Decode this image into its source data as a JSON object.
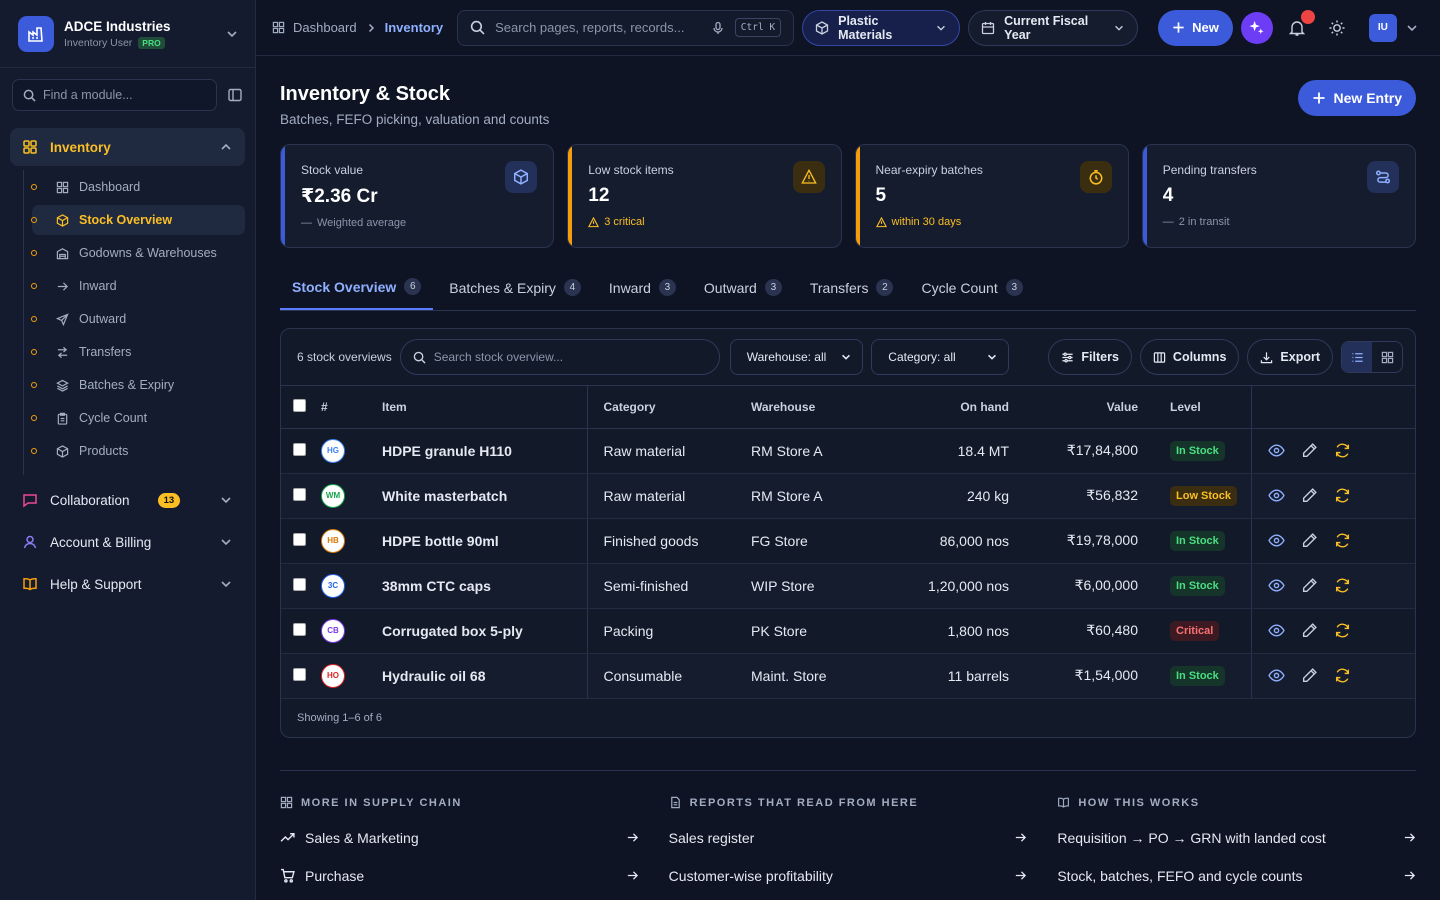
{
  "brand": {
    "name": "ADCE Industries",
    "role": "Inventory User",
    "plan": "PRO"
  },
  "sidebar": {
    "search_placeholder": "Find a module...",
    "group_inventory": "Inventory",
    "sub_items": [
      {
        "label": "Dashboard"
      },
      {
        "label": "Stock Overview"
      },
      {
        "label": "Godowns & Warehouses"
      },
      {
        "label": "Inward"
      },
      {
        "label": "Outward"
      },
      {
        "label": "Transfers"
      },
      {
        "label": "Batches & Expiry"
      },
      {
        "label": "Cycle Count"
      },
      {
        "label": "Products"
      }
    ],
    "collaboration": "Collaboration",
    "collab_badge": "13",
    "account": "Account & Billing",
    "help": "Help & Support"
  },
  "topbar": {
    "crumb_root": "Dashboard",
    "crumb_current": "Inventory",
    "search_placeholder": "Search pages, reports, records...",
    "shortcut": "Ctrl K",
    "context": "Plastic Materials",
    "period": "Current Fiscal Year",
    "new_label": "New",
    "user_initials": "IU"
  },
  "page": {
    "title": "Inventory & Stock",
    "subtitle": "Batches, FEFO picking, valuation and counts",
    "new_entry": "New Entry"
  },
  "kpis": [
    {
      "label": "Stock value",
      "value": "₹2.36 Cr",
      "note": "Weighted average",
      "color": "#3b5bdb"
    },
    {
      "label": "Low stock items",
      "value": "12",
      "note": "3 critical",
      "color": "#f59e0b"
    },
    {
      "label": "Near-expiry batches",
      "value": "5",
      "note": "within 30 days",
      "color": "#f59e0b"
    },
    {
      "label": "Pending transfers",
      "value": "4",
      "note": "2 in transit",
      "color": "#3b5bdb"
    }
  ],
  "tabs": [
    {
      "label": "Stock Overview",
      "count": "6"
    },
    {
      "label": "Batches & Expiry",
      "count": "4"
    },
    {
      "label": "Inward",
      "count": "3"
    },
    {
      "label": "Outward",
      "count": "3"
    },
    {
      "label": "Transfers",
      "count": "2"
    },
    {
      "label": "Cycle Count",
      "count": "3"
    }
  ],
  "table": {
    "count_label": "6 stock overviews",
    "search_placeholder": "Search stock overview...",
    "warehouse_filter": "Warehouse: all",
    "category_filter": "Category: all",
    "filters": "Filters",
    "columns_btn": "Columns",
    "export": "Export",
    "headers": {
      "num": "#",
      "item": "Item",
      "category": "Category",
      "warehouse": "Warehouse",
      "onhand": "On hand",
      "value": "Value",
      "level": "Level"
    },
    "rows": [
      {
        "ini": "HG",
        "color": "#3b82f6",
        "item": "HDPE granule H110",
        "category": "Raw material",
        "warehouse": "RM Store A",
        "onhand": "18.4 MT",
        "value": "₹17,84,800",
        "level": "In Stock",
        "lvl": "in"
      },
      {
        "ini": "WM",
        "color": "#16a34a",
        "item": "White masterbatch",
        "category": "Raw material",
        "warehouse": "RM Store A",
        "onhand": "240 kg",
        "value": "₹56,832",
        "level": "Low Stock",
        "lvl": "low"
      },
      {
        "ini": "HB",
        "color": "#d97706",
        "item": "HDPE bottle 90ml",
        "category": "Finished goods",
        "warehouse": "FG Store",
        "onhand": "86,000 nos",
        "value": "₹19,78,000",
        "level": "In Stock",
        "lvl": "in"
      },
      {
        "ini": "3C",
        "color": "#2563eb",
        "item": "38mm CTC caps",
        "category": "Semi-finished",
        "warehouse": "WIP Store",
        "onhand": "1,20,000 nos",
        "value": "₹6,00,000",
        "level": "In Stock",
        "lvl": "in"
      },
      {
        "ini": "CB",
        "color": "#7c3aed",
        "item": "Corrugated box 5-ply",
        "category": "Packing",
        "warehouse": "PK Store",
        "onhand": "1,800 nos",
        "value": "₹60,480",
        "level": "Critical",
        "lvl": "crit"
      },
      {
        "ini": "HO",
        "color": "#dc2626",
        "item": "Hydraulic oil 68",
        "category": "Consumable",
        "warehouse": "Maint. Store",
        "onhand": "11 barrels",
        "value": "₹1,54,000",
        "level": "In Stock",
        "lvl": "in"
      }
    ],
    "showing": "Showing 1–6 of 6"
  },
  "more": {
    "col1": {
      "title": "MORE IN SUPPLY CHAIN",
      "links": [
        "Sales & Marketing",
        "Purchase"
      ]
    },
    "col2": {
      "title": "REPORTS THAT READ FROM HERE",
      "links": [
        "Sales register",
        "Customer-wise profitability"
      ]
    },
    "col3": {
      "title": "HOW THIS WORKS",
      "links": [
        "Requisition → PO → GRN with landed cost",
        "Stock, batches, FEFO and cycle counts"
      ]
    }
  }
}
